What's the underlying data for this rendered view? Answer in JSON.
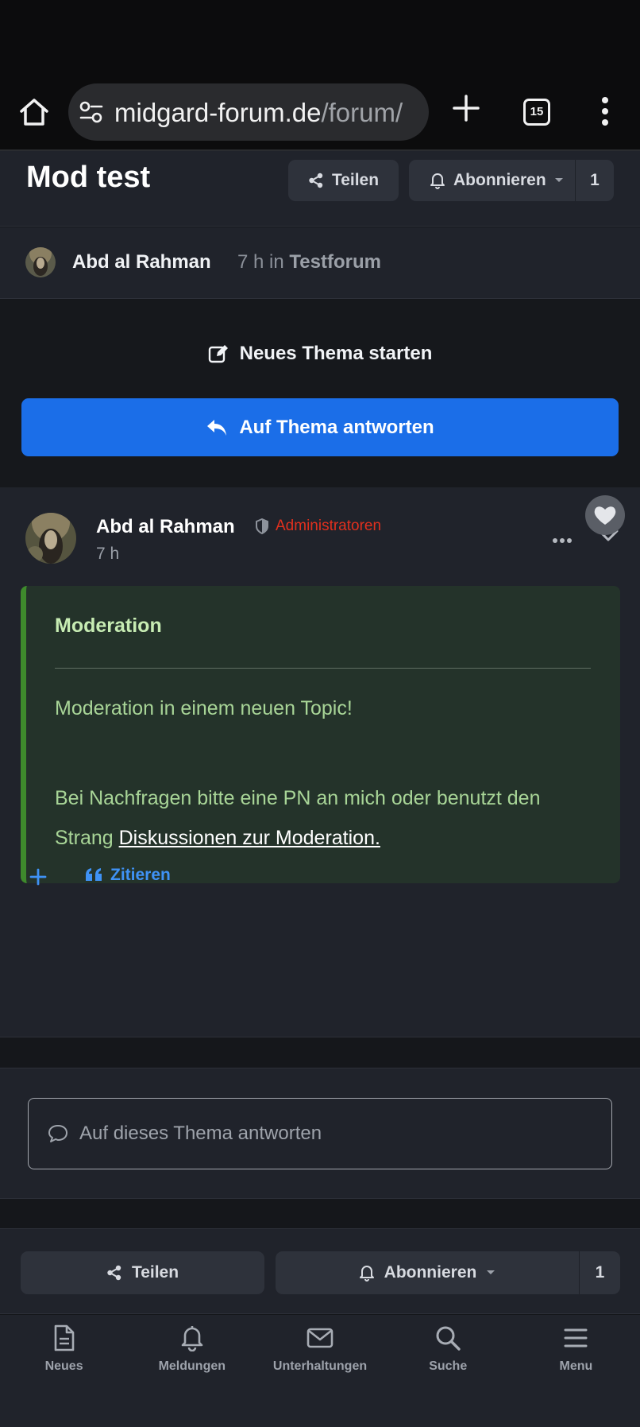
{
  "browser": {
    "url_domain": "midgard-forum.de",
    "url_path": "/forum/",
    "tab_count": "15"
  },
  "topic": {
    "title": "Mod test",
    "share_label": "Teilen",
    "subscribe_label": "Abonnieren",
    "subscribe_count": "1"
  },
  "author_row": {
    "name": "Abd al Rahman",
    "time": "7 h in",
    "forum": "Testforum"
  },
  "actions": {
    "new_topic_label": "Neues Thema starten",
    "reply_label": "Auf Thema antworten"
  },
  "post": {
    "author": "Abd al Rahman",
    "role": "Administratoren",
    "time": "7 h",
    "moderation": {
      "title": "Moderation",
      "line1": "Moderation in einem neuen Topic!",
      "line2_prefix": "Bei Nachfragen bitte eine PN an mich oder benutzt den Strang ",
      "link_text": "Diskussionen zur Moderation."
    },
    "quote_label": "Zitieren"
  },
  "reply_box": {
    "placeholder": "Auf dieses Thema antworten"
  },
  "bottom_actions": {
    "share_label": "Teilen",
    "subscribe_label": "Abonnieren",
    "subscribe_count": "1"
  },
  "bottom_nav": {
    "items": [
      {
        "label": "Neues",
        "icon": "document-icon"
      },
      {
        "label": "Meldungen",
        "icon": "bell-icon"
      },
      {
        "label": "Unterhaltungen",
        "icon": "envelope-icon"
      },
      {
        "label": "Suche",
        "icon": "search-icon"
      },
      {
        "label": "Menu",
        "icon": "menu-icon"
      }
    ]
  },
  "colors": {
    "accent": "#1b6ee8",
    "role": "#e0301e",
    "moderation_bg": "#24332a",
    "moderation_border": "#3e8a2c",
    "link": "#3f92f5"
  }
}
